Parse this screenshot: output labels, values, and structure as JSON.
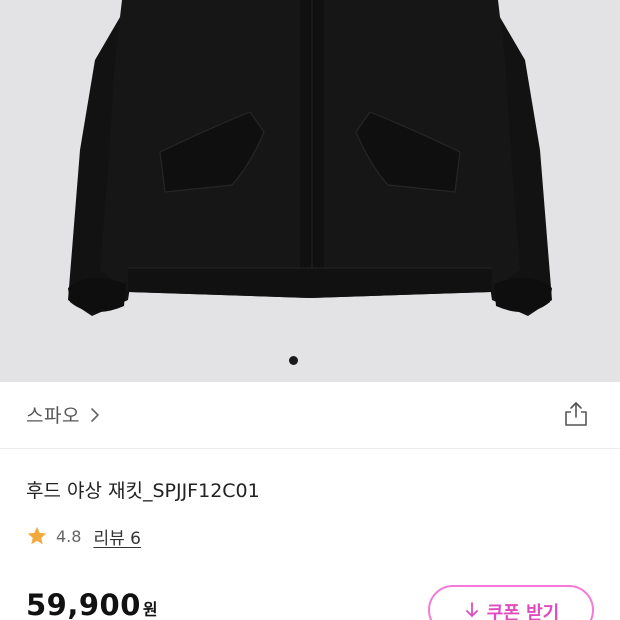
{
  "brand": {
    "name": "스파오"
  },
  "product": {
    "title": "후드 야상 재킷_SPJJF12C01",
    "rating": "4.8",
    "review_label": "리뷰 6",
    "price": "59,900",
    "price_unit": "원"
  },
  "coupon": {
    "label": "쿠폰 받기"
  },
  "carousel": {
    "current": 1,
    "total": 1
  },
  "icons": {
    "brand_chevron": "chevron-right-icon",
    "share": "share-icon",
    "star": "star-icon",
    "coupon": "download-icon"
  },
  "colors": {
    "hero_bg": "#e3e3e6",
    "star": "#f2a93b",
    "coupon_border": "#f57ad7",
    "coupon_text": "#e04cc0"
  }
}
